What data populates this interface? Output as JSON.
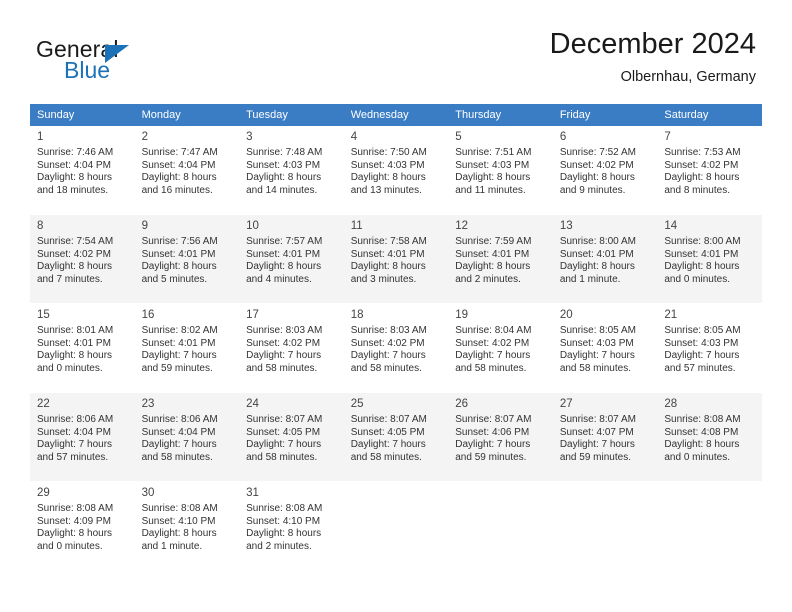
{
  "brand": {
    "name_part1": "General",
    "name_part2": "Blue",
    "logo_icon": "triangle-icon"
  },
  "header": {
    "title": "December 2024",
    "subtitle": "Olbernhau, Germany"
  },
  "colors": {
    "header_blue": "#3b7dc4",
    "brand_blue": "#1b72b8",
    "alt_row": "#f4f4f4",
    "text": "#333333"
  },
  "calendar": {
    "weekday_headers": [
      "Sunday",
      "Monday",
      "Tuesday",
      "Wednesday",
      "Thursday",
      "Friday",
      "Saturday"
    ],
    "weeks": [
      {
        "alt": false,
        "days": [
          {
            "day": "1",
            "sunrise": "Sunrise: 7:46 AM",
            "sunset": "Sunset: 4:04 PM",
            "daylight_line1": "Daylight: 8 hours",
            "daylight_line2": "and 18 minutes."
          },
          {
            "day": "2",
            "sunrise": "Sunrise: 7:47 AM",
            "sunset": "Sunset: 4:04 PM",
            "daylight_line1": "Daylight: 8 hours",
            "daylight_line2": "and 16 minutes."
          },
          {
            "day": "3",
            "sunrise": "Sunrise: 7:48 AM",
            "sunset": "Sunset: 4:03 PM",
            "daylight_line1": "Daylight: 8 hours",
            "daylight_line2": "and 14 minutes."
          },
          {
            "day": "4",
            "sunrise": "Sunrise: 7:50 AM",
            "sunset": "Sunset: 4:03 PM",
            "daylight_line1": "Daylight: 8 hours",
            "daylight_line2": "and 13 minutes."
          },
          {
            "day": "5",
            "sunrise": "Sunrise: 7:51 AM",
            "sunset": "Sunset: 4:03 PM",
            "daylight_line1": "Daylight: 8 hours",
            "daylight_line2": "and 11 minutes."
          },
          {
            "day": "6",
            "sunrise": "Sunrise: 7:52 AM",
            "sunset": "Sunset: 4:02 PM",
            "daylight_line1": "Daylight: 8 hours",
            "daylight_line2": "and 9 minutes."
          },
          {
            "day": "7",
            "sunrise": "Sunrise: 7:53 AM",
            "sunset": "Sunset: 4:02 PM",
            "daylight_line1": "Daylight: 8 hours",
            "daylight_line2": "and 8 minutes."
          }
        ]
      },
      {
        "alt": true,
        "days": [
          {
            "day": "8",
            "sunrise": "Sunrise: 7:54 AM",
            "sunset": "Sunset: 4:02 PM",
            "daylight_line1": "Daylight: 8 hours",
            "daylight_line2": "and 7 minutes."
          },
          {
            "day": "9",
            "sunrise": "Sunrise: 7:56 AM",
            "sunset": "Sunset: 4:01 PM",
            "daylight_line1": "Daylight: 8 hours",
            "daylight_line2": "and 5 minutes."
          },
          {
            "day": "10",
            "sunrise": "Sunrise: 7:57 AM",
            "sunset": "Sunset: 4:01 PM",
            "daylight_line1": "Daylight: 8 hours",
            "daylight_line2": "and 4 minutes."
          },
          {
            "day": "11",
            "sunrise": "Sunrise: 7:58 AM",
            "sunset": "Sunset: 4:01 PM",
            "daylight_line1": "Daylight: 8 hours",
            "daylight_line2": "and 3 minutes."
          },
          {
            "day": "12",
            "sunrise": "Sunrise: 7:59 AM",
            "sunset": "Sunset: 4:01 PM",
            "daylight_line1": "Daylight: 8 hours",
            "daylight_line2": "and 2 minutes."
          },
          {
            "day": "13",
            "sunrise": "Sunrise: 8:00 AM",
            "sunset": "Sunset: 4:01 PM",
            "daylight_line1": "Daylight: 8 hours",
            "daylight_line2": "and 1 minute."
          },
          {
            "day": "14",
            "sunrise": "Sunrise: 8:00 AM",
            "sunset": "Sunset: 4:01 PM",
            "daylight_line1": "Daylight: 8 hours",
            "daylight_line2": "and 0 minutes."
          }
        ]
      },
      {
        "alt": false,
        "days": [
          {
            "day": "15",
            "sunrise": "Sunrise: 8:01 AM",
            "sunset": "Sunset: 4:01 PM",
            "daylight_line1": "Daylight: 8 hours",
            "daylight_line2": "and 0 minutes."
          },
          {
            "day": "16",
            "sunrise": "Sunrise: 8:02 AM",
            "sunset": "Sunset: 4:01 PM",
            "daylight_line1": "Daylight: 7 hours",
            "daylight_line2": "and 59 minutes."
          },
          {
            "day": "17",
            "sunrise": "Sunrise: 8:03 AM",
            "sunset": "Sunset: 4:02 PM",
            "daylight_line1": "Daylight: 7 hours",
            "daylight_line2": "and 58 minutes."
          },
          {
            "day": "18",
            "sunrise": "Sunrise: 8:03 AM",
            "sunset": "Sunset: 4:02 PM",
            "daylight_line1": "Daylight: 7 hours",
            "daylight_line2": "and 58 minutes."
          },
          {
            "day": "19",
            "sunrise": "Sunrise: 8:04 AM",
            "sunset": "Sunset: 4:02 PM",
            "daylight_line1": "Daylight: 7 hours",
            "daylight_line2": "and 58 minutes."
          },
          {
            "day": "20",
            "sunrise": "Sunrise: 8:05 AM",
            "sunset": "Sunset: 4:03 PM",
            "daylight_line1": "Daylight: 7 hours",
            "daylight_line2": "and 58 minutes."
          },
          {
            "day": "21",
            "sunrise": "Sunrise: 8:05 AM",
            "sunset": "Sunset: 4:03 PM",
            "daylight_line1": "Daylight: 7 hours",
            "daylight_line2": "and 57 minutes."
          }
        ]
      },
      {
        "alt": true,
        "days": [
          {
            "day": "22",
            "sunrise": "Sunrise: 8:06 AM",
            "sunset": "Sunset: 4:04 PM",
            "daylight_line1": "Daylight: 7 hours",
            "daylight_line2": "and 57 minutes."
          },
          {
            "day": "23",
            "sunrise": "Sunrise: 8:06 AM",
            "sunset": "Sunset: 4:04 PM",
            "daylight_line1": "Daylight: 7 hours",
            "daylight_line2": "and 58 minutes."
          },
          {
            "day": "24",
            "sunrise": "Sunrise: 8:07 AM",
            "sunset": "Sunset: 4:05 PM",
            "daylight_line1": "Daylight: 7 hours",
            "daylight_line2": "and 58 minutes."
          },
          {
            "day": "25",
            "sunrise": "Sunrise: 8:07 AM",
            "sunset": "Sunset: 4:05 PM",
            "daylight_line1": "Daylight: 7 hours",
            "daylight_line2": "and 58 minutes."
          },
          {
            "day": "26",
            "sunrise": "Sunrise: 8:07 AM",
            "sunset": "Sunset: 4:06 PM",
            "daylight_line1": "Daylight: 7 hours",
            "daylight_line2": "and 59 minutes."
          },
          {
            "day": "27",
            "sunrise": "Sunrise: 8:07 AM",
            "sunset": "Sunset: 4:07 PM",
            "daylight_line1": "Daylight: 7 hours",
            "daylight_line2": "and 59 minutes."
          },
          {
            "day": "28",
            "sunrise": "Sunrise: 8:08 AM",
            "sunset": "Sunset: 4:08 PM",
            "daylight_line1": "Daylight: 8 hours",
            "daylight_line2": "and 0 minutes."
          }
        ]
      },
      {
        "alt": false,
        "days": [
          {
            "day": "29",
            "sunrise": "Sunrise: 8:08 AM",
            "sunset": "Sunset: 4:09 PM",
            "daylight_line1": "Daylight: 8 hours",
            "daylight_line2": "and 0 minutes."
          },
          {
            "day": "30",
            "sunrise": "Sunrise: 8:08 AM",
            "sunset": "Sunset: 4:10 PM",
            "daylight_line1": "Daylight: 8 hours",
            "daylight_line2": "and 1 minute."
          },
          {
            "day": "31",
            "sunrise": "Sunrise: 8:08 AM",
            "sunset": "Sunset: 4:10 PM",
            "daylight_line1": "Daylight: 8 hours",
            "daylight_line2": "and 2 minutes."
          },
          {
            "day": "",
            "sunrise": "",
            "sunset": "",
            "daylight_line1": "",
            "daylight_line2": ""
          },
          {
            "day": "",
            "sunrise": "",
            "sunset": "",
            "daylight_line1": "",
            "daylight_line2": ""
          },
          {
            "day": "",
            "sunrise": "",
            "sunset": "",
            "daylight_line1": "",
            "daylight_line2": ""
          },
          {
            "day": "",
            "sunrise": "",
            "sunset": "",
            "daylight_line1": "",
            "daylight_line2": ""
          }
        ]
      }
    ]
  }
}
